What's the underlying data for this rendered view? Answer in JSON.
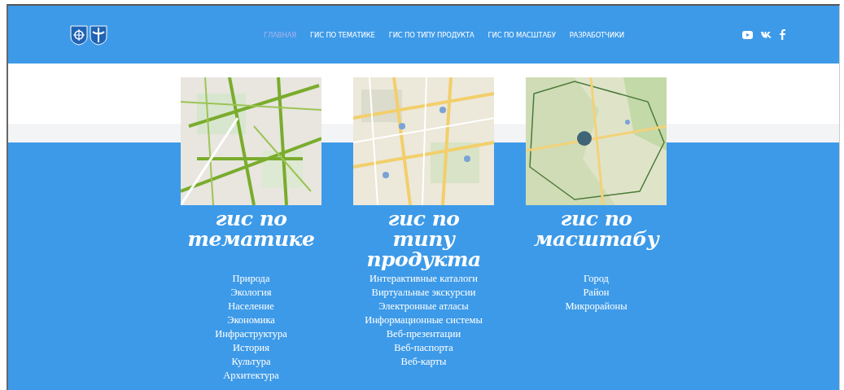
{
  "header": {
    "nav": [
      {
        "label": "ГЛАВНАЯ",
        "selected": true
      },
      {
        "label": "ГИС ПО ТЕМАТИКЕ",
        "selected": false
      },
      {
        "label": "ГИС ПО ТИПУ ПРОДУКТА",
        "selected": false
      },
      {
        "label": "ГИС ПО МАСШТАБУ",
        "selected": false
      },
      {
        "label": "РАЗРАБОТЧИКИ",
        "selected": false
      }
    ]
  },
  "sections": [
    {
      "image": {
        "kind": "picture"
      },
      "title": [
        "гис по",
        "тематике"
      ],
      "links": [
        "Природа",
        "Экология",
        "Население",
        "Экономика",
        "Инфраструктура",
        "История",
        "Культура",
        "Архитектура"
      ]
    },
    {
      "image": {
        "kind": "picture"
      },
      "title": [
        "гис по",
        "типу",
        "продукта"
      ],
      "links": [
        "Интерактивные каталоги",
        "Виртуальные экскурсии",
        "Электронные атласы",
        "Информационные системы",
        "Веб-презентации",
        "Веб-паспорта",
        "Веб-карты"
      ]
    },
    {
      "image": {
        "kind": "picture"
      },
      "title": [
        "гис по",
        "масштабу"
      ],
      "links": [
        "Город",
        "Район",
        "Микрорайоны"
      ]
    }
  ]
}
